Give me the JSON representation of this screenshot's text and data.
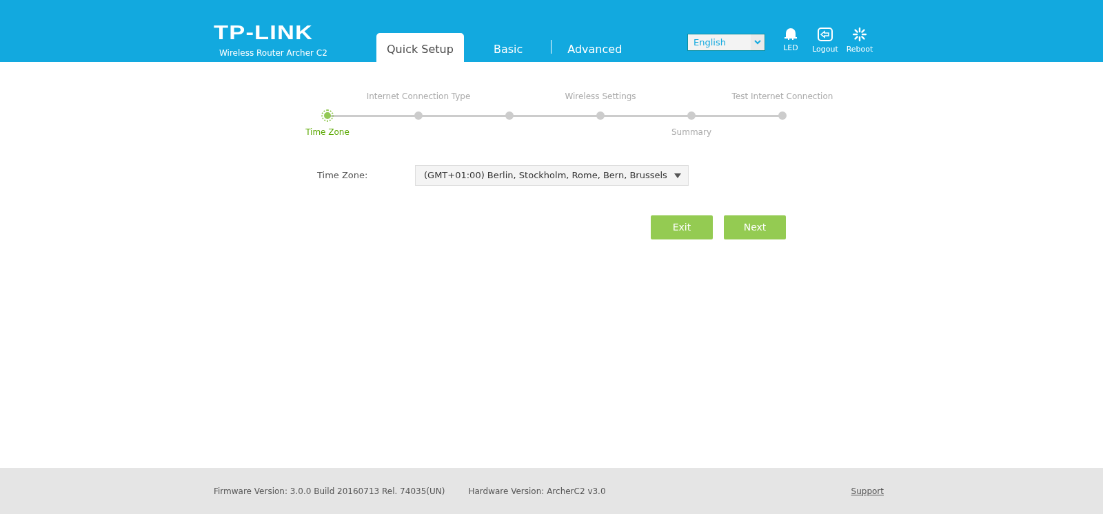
{
  "header": {
    "logo": "TP-LINK",
    "model": "Wireless Router Archer C2",
    "tabs": [
      {
        "label": "Quick Setup",
        "selected": true
      },
      {
        "label": "Basic",
        "selected": false
      },
      {
        "label": "Advanced",
        "selected": false
      }
    ],
    "language": "English",
    "tools": [
      {
        "kind": "led",
        "label": "LED"
      },
      {
        "kind": "logout",
        "label": "Logout"
      },
      {
        "kind": "reboot",
        "label": "Reboot"
      }
    ]
  },
  "steps": [
    {
      "label": "Time Zone",
      "kind": "below",
      "selected": true
    },
    {
      "label": "Internet Connection Type",
      "kind": "above",
      "selected": false
    },
    {
      "selected": false
    },
    {
      "label": "Wireless Settings",
      "kind": "above",
      "selected": false
    },
    {
      "label": "Summary",
      "kind": "below",
      "selected": false
    },
    {
      "label": "Test Internet Connection",
      "kind": "above",
      "selected": false
    }
  ],
  "form": {
    "label": "Time Zone:",
    "value": "(GMT+01:00) Berlin, Stockholm, Rome, Bern, Brussels"
  },
  "buttons": [
    "Exit",
    "Next"
  ],
  "footer": {
    "firmware": "Firmware Version: 3.0.0 Build 20160713 Rel. 74035(UN)",
    "hardware": "Hardware Version: ArcherC2 v3.0",
    "support": "Support"
  }
}
